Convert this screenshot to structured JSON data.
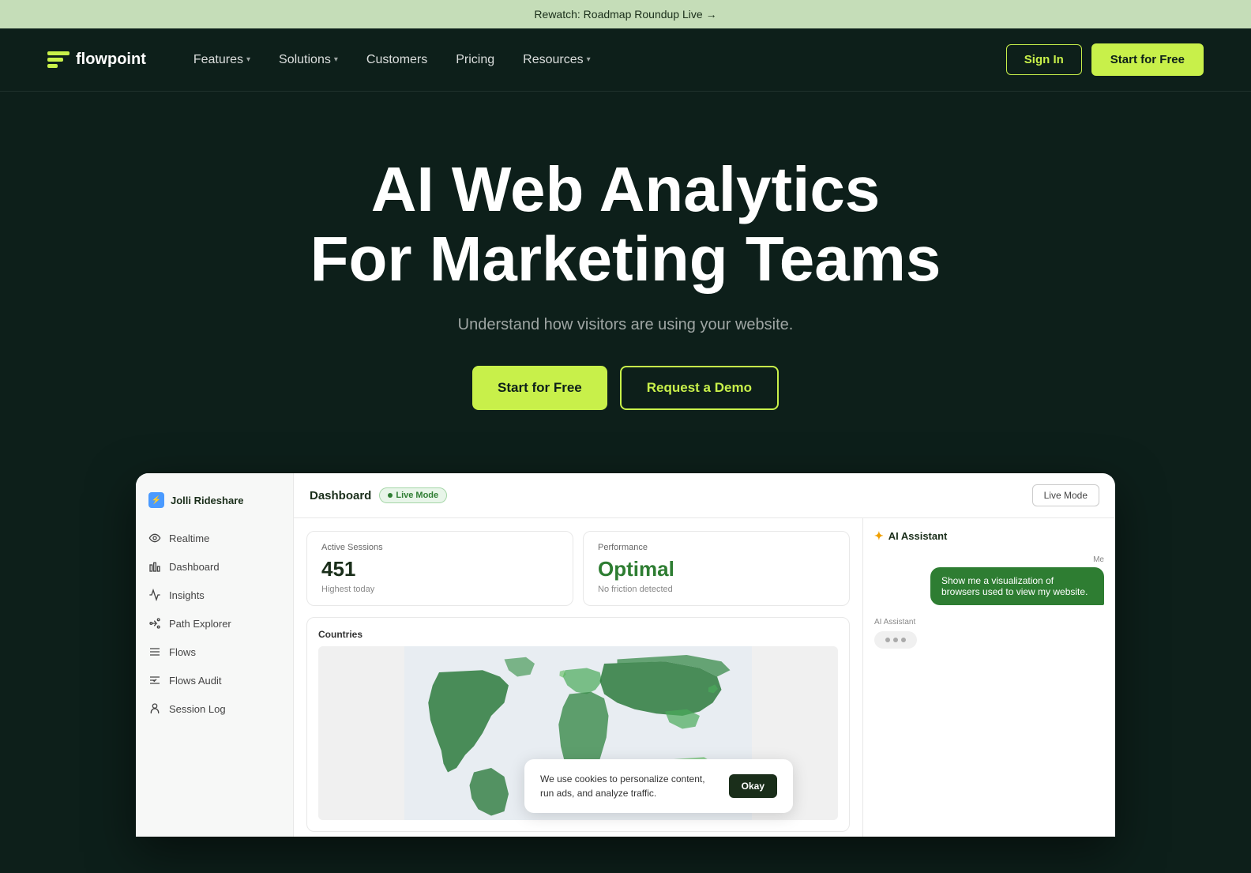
{
  "banner": {
    "text": "Rewatch: Roadmap Roundup Live",
    "arrow": "→"
  },
  "nav": {
    "logo": "flowpoint",
    "links": [
      {
        "label": "Features",
        "has_dropdown": true
      },
      {
        "label": "Solutions",
        "has_dropdown": true
      },
      {
        "label": "Customers",
        "has_dropdown": false
      },
      {
        "label": "Pricing",
        "has_dropdown": false
      },
      {
        "label": "Resources",
        "has_dropdown": true
      }
    ],
    "sign_in": "Sign In",
    "start_free": "Start for Free"
  },
  "hero": {
    "headline_line1": "AI Web Analytics",
    "headline_line2": "For Marketing Teams",
    "subtext": "Understand how visitors are using your website.",
    "btn_primary": "Start for Free",
    "btn_secondary": "Request a Demo"
  },
  "dashboard": {
    "brand": "Jolli Rideshare",
    "title": "Dashboard",
    "live_badge": "Live Mode",
    "live_mode_btn": "Live Mode",
    "sidebar": [
      {
        "icon": "eye",
        "label": "Realtime"
      },
      {
        "icon": "bar-chart",
        "label": "Dashboard"
      },
      {
        "icon": "insights",
        "label": "Insights"
      },
      {
        "icon": "path",
        "label": "Path Explorer"
      },
      {
        "icon": "flows",
        "label": "Flows"
      },
      {
        "icon": "flows-audit",
        "label": "Flows Audit"
      },
      {
        "icon": "session",
        "label": "Session Log"
      }
    ],
    "active_sessions": {
      "label": "Active Sessions",
      "value": "451",
      "sub": "Highest today"
    },
    "performance": {
      "label": "Performance",
      "value": "Optimal",
      "sub": "No friction detected"
    },
    "countries_label": "Countries",
    "ai_assistant_label": "AI Assistant",
    "chat_me_label": "Me",
    "chat_me_text": "Show me a visualization of browsers used to view my website.",
    "ai_label": "AI Assistant",
    "cookie": {
      "text": "We use cookies to personalize content, run ads, and analyze traffic.",
      "btn": "Okay"
    }
  }
}
